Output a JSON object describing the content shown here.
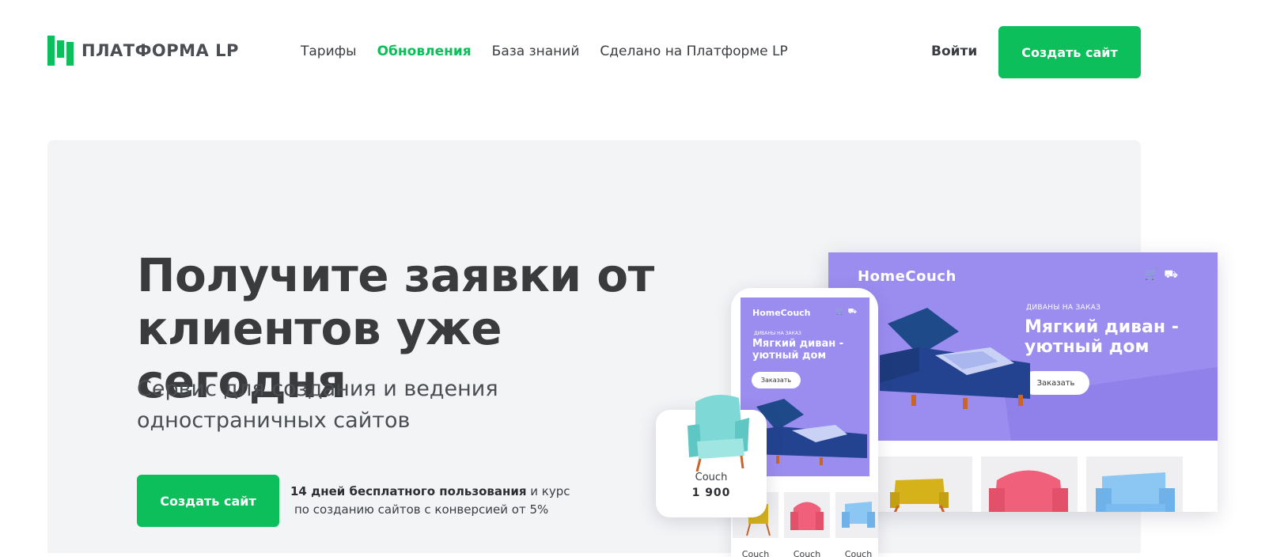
{
  "header": {
    "logo_text": "ПЛАТФОРМА LP",
    "nav": [
      {
        "label": "Тарифы",
        "active": false
      },
      {
        "label": "Обновления",
        "active": true
      },
      {
        "label": "База знаний",
        "active": false
      },
      {
        "label": "Сделано на Платформе LP",
        "active": false
      }
    ],
    "login_label": "Войти",
    "cta_label": "Создать сайт"
  },
  "hero": {
    "title_line1": "Получите заявки от",
    "title_line2": "клиентов уже сегодня",
    "subtitle_line1": "Сервис для создания и ведения",
    "subtitle_line2": "одностраничных сайтов",
    "cta_label": "Создать сайт",
    "trial_bold": "14 дней бесплатного пользования",
    "trial_rest": " и курс",
    "trial_line2": "по созданию сайтов с конверсией от 5%"
  },
  "mockup": {
    "brand": "HomeCouch",
    "kicker": "ДИВАНЫ НА ЗАКАЗ",
    "headline_line1": "Мягкий диван -",
    "headline_line2": "уютный дом",
    "order_label": "Заказать",
    "product_label": "Couch",
    "product_price": "1 900",
    "icons": [
      "cart-icon",
      "truck-icon"
    ]
  },
  "colors": {
    "brand_green": "#0cbf5a",
    "mockup_purple": "#9b8cf0",
    "hero_bg": "#f3f4f6",
    "text_dark": "#3a3b3d"
  }
}
